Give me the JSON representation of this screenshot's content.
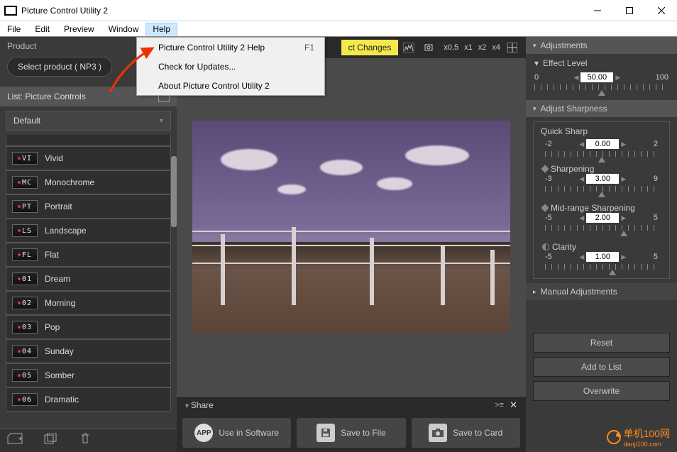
{
  "app": {
    "title": "Picture Control Utility 2"
  },
  "menu": {
    "items": [
      "File",
      "Edit",
      "Preview",
      "Window",
      "Help"
    ],
    "active": "Help"
  },
  "help_menu": {
    "items": [
      {
        "label": "Picture Control Utility 2 Help",
        "shortcut": "F1"
      },
      {
        "label": "Check for Updates..."
      },
      {
        "label": "About Picture Control Utility 2"
      }
    ]
  },
  "product": {
    "label": "Product",
    "selected": "Select product ( NP3 )"
  },
  "list": {
    "header": "List: Picture Controls",
    "default": "Default",
    "items": [
      {
        "badge": "VI",
        "name": "Vivid"
      },
      {
        "badge": "MC",
        "name": "Monochrome"
      },
      {
        "badge": "PT",
        "name": "Portrait"
      },
      {
        "badge": "LS",
        "name": "Landscape"
      },
      {
        "badge": "FL",
        "name": "Flat"
      },
      {
        "badge": "01",
        "name": "Dream"
      },
      {
        "badge": "02",
        "name": "Morning"
      },
      {
        "badge": "03",
        "name": "Pop"
      },
      {
        "badge": "04",
        "name": "Sunday"
      },
      {
        "badge": "05",
        "name": "Somber"
      },
      {
        "badge": "06",
        "name": "Dramatic"
      }
    ]
  },
  "center": {
    "reflect_label": "ct Changes",
    "zoom": [
      "x0,5",
      "x1",
      "x2",
      "x4"
    ]
  },
  "share": {
    "header": "Share",
    "buttons": [
      {
        "icon": "APP",
        "label": "Use in Software"
      },
      {
        "icon": "disk",
        "label": "Save to File"
      },
      {
        "icon": "camera",
        "label": "Save to Card"
      }
    ]
  },
  "adjustments": {
    "header": "Adjustments",
    "effect": {
      "label": "Effect Level",
      "min": "0",
      "max": "100",
      "value": "50.00"
    },
    "sharp_header": "Adjust Sharpness",
    "quick": {
      "label": "Quick Sharp",
      "min": "-2",
      "max": "2",
      "value": "0.00"
    },
    "sharpening": {
      "label": "Sharpening",
      "min": "-3",
      "max": "9",
      "value": "3.00"
    },
    "midrange": {
      "label": "Mid-range Sharpening",
      "min": "-5",
      "max": "5",
      "value": "2.00"
    },
    "clarity": {
      "label": "Clarity",
      "min": "-5",
      "max": "5",
      "value": "1.00"
    },
    "manual": "Manual Adjustments",
    "reset": "Reset",
    "add": "Add to List",
    "overwrite": "Overwrite"
  },
  "watermark": {
    "main": "单机100网",
    "sub": "danji100.com"
  }
}
